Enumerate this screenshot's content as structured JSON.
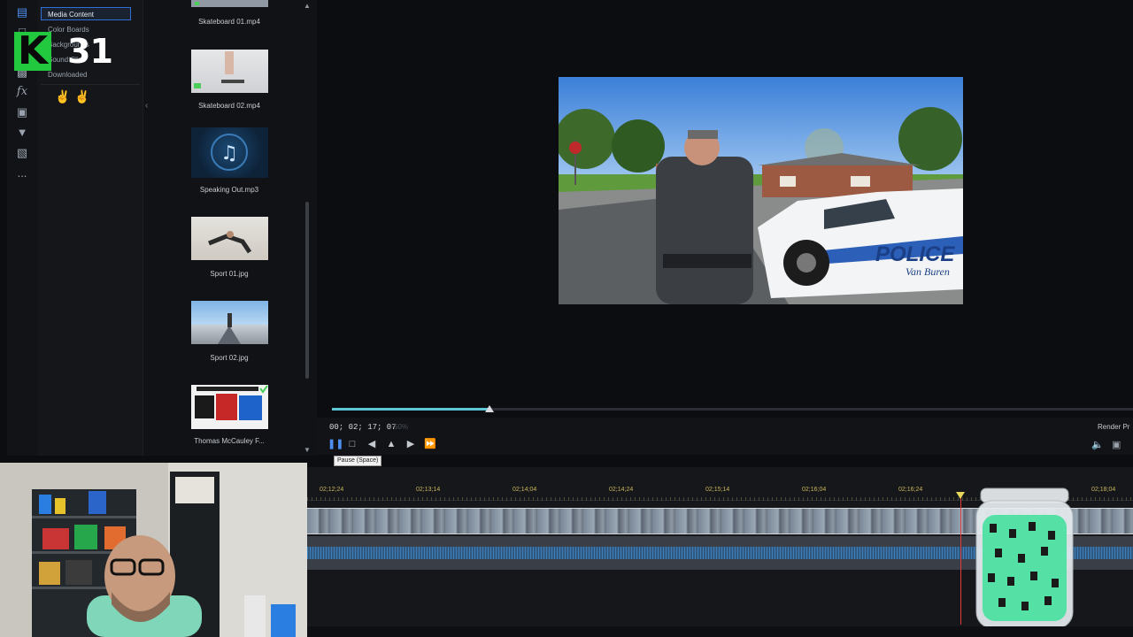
{
  "overlay": {
    "logo_letter": "K",
    "number": "31"
  },
  "library": {
    "categories": [
      {
        "label": "Media Content",
        "active": true
      },
      {
        "label": "Color Boards"
      },
      {
        "label": "Backgrounds"
      },
      {
        "label": "Sound Clips"
      },
      {
        "label": "Downloaded"
      }
    ],
    "rail_icons": [
      "media-library-icon",
      "title-icon",
      "transition-icon",
      "fx-icon",
      "overlay-icon",
      "particle-icon",
      "template-icon",
      "more-icon"
    ],
    "rail_fx": "fx",
    "rail_more": "..."
  },
  "media": {
    "items": [
      {
        "name": "Skateboard 01.mp4",
        "kind": "video"
      },
      {
        "name": "Skateboard 02.mp4",
        "kind": "video"
      },
      {
        "name": "Speaking Out.mp3",
        "kind": "audio"
      },
      {
        "name": "Sport 01.jpg",
        "kind": "image"
      },
      {
        "name": "Sport 02.jpg",
        "kind": "image"
      },
      {
        "name": "Thomas McCauley F...",
        "kind": "image"
      }
    ]
  },
  "preview": {
    "video_text": "POLICE",
    "video_text2": "Van Buren",
    "timecode": "00; 02; 17; 07",
    "zoom": "50%",
    "progress": 0.197,
    "render_label": "Render Pr"
  },
  "playback": {
    "tooltip": "Pause (Space)",
    "buttons": [
      "pause",
      "stop",
      "previous-frame",
      "next-frame",
      "fast-forward"
    ]
  },
  "timeline": {
    "ruler_labels": [
      "02;12;24",
      "02;13;14",
      "02;14;04",
      "02;14;24",
      "02;15;14",
      "02;16;04",
      "02;16;24",
      "02;18;04"
    ]
  },
  "colors": {
    "accent": "#2f6fd6",
    "seek": "#5ec7d6",
    "playhead": "#e23b3b",
    "logo": "#22c93e"
  }
}
